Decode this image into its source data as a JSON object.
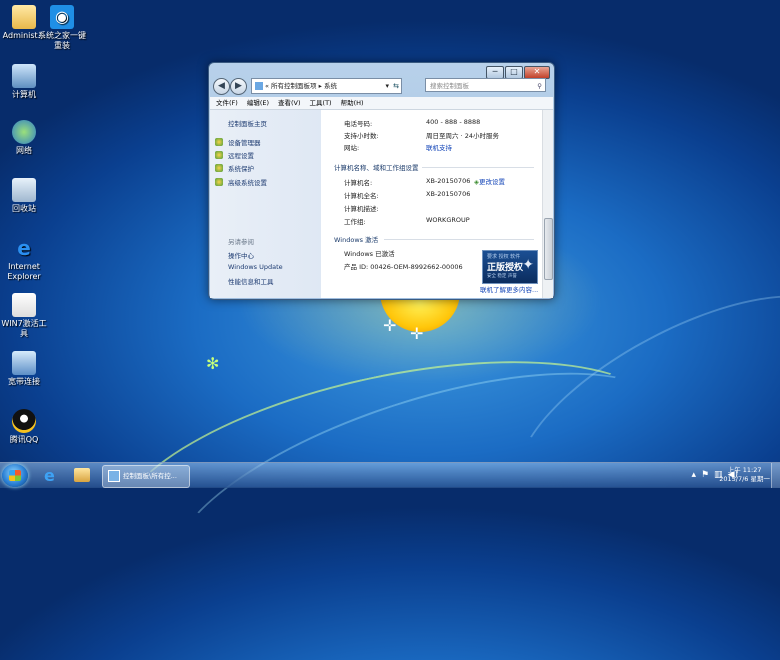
{
  "desktop": {
    "icons": [
      {
        "label": "Administ..."
      },
      {
        "label": "系统之家一键重装"
      },
      {
        "label": "计算机"
      },
      {
        "label": "网络"
      },
      {
        "label": "回收站"
      },
      {
        "label": "Internet Explorer"
      },
      {
        "label": "WIN7激活工具"
      },
      {
        "label": "宽带连接"
      },
      {
        "label": "腾讯QQ"
      }
    ]
  },
  "window": {
    "breadcrumb": "« 所有控制面板项 ▸ 系统",
    "search_placeholder": "搜索控制面板",
    "caption": {
      "minimize": "─",
      "maximize": "□",
      "close": "✕"
    },
    "menu": [
      "文件(F)",
      "编辑(E)",
      "查看(V)",
      "工具(T)",
      "帮助(H)"
    ],
    "left": {
      "home": "控制面板主页",
      "items": [
        "设备管理器",
        "远程设置",
        "系统保护",
        "高级系统设置"
      ],
      "see_also_header": "另请参阅",
      "see_also": [
        "操作中心",
        "Windows Update",
        "性能信息和工具"
      ]
    },
    "support": {
      "phone_label": "电话号码:",
      "phone": "400 - 888 - 8888",
      "hours_label": "支持小时数:",
      "hours": "周日至周六 · 24小时服务",
      "site_label": "网站:",
      "site": "联机支持"
    },
    "computer": {
      "section": "计算机名称、域和工作组设置",
      "name_label": "计算机名:",
      "name": "XB-20150706",
      "fullname_label": "计算机全名:",
      "fullname": "XB-20150706",
      "desc_label": "计算机描述:",
      "workgroup_label": "工作组:",
      "workgroup": "WORKGROUP",
      "change": "更改设置"
    },
    "activation": {
      "section": "Windows 激活",
      "status": "Windows 已激活",
      "product_id": "产品 ID: 00426-OEM-8992662-00006",
      "more": "联机了解更多内容...",
      "badge_top": "要求 授权 软件",
      "badge_main": "正版授权",
      "badge_bottom": "安全 稳定 声誉"
    }
  },
  "taskbar": {
    "task_label": "控制面板\\所有控...",
    "time": "上午 11:27",
    "date": "2015/7/6 星期一"
  }
}
